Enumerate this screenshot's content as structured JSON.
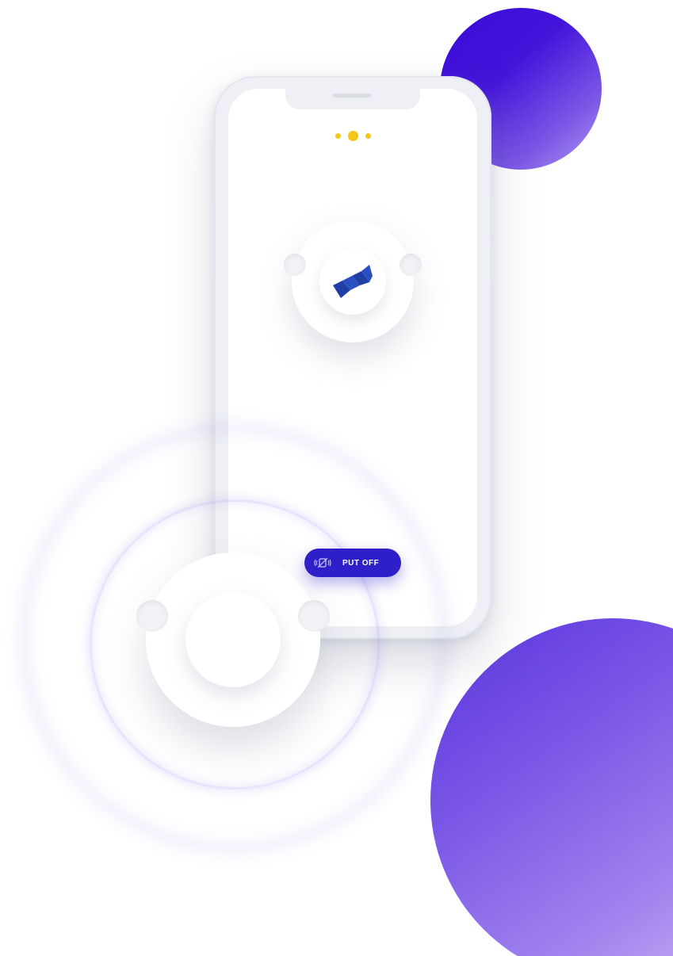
{
  "colors": {
    "accent": "#2f1fc9",
    "indicator": "#f5c518",
    "bubble_top": "#3a0bd8",
    "bubble_bottom": "#7a57e6",
    "logo_blue": "#1f3fa6"
  },
  "pager": {
    "count": 3,
    "active_index": 1
  },
  "logo": {
    "icon": "brand-logo-icon"
  },
  "action": {
    "label": "PUT OFF",
    "icon": "vibration-off-icon"
  }
}
